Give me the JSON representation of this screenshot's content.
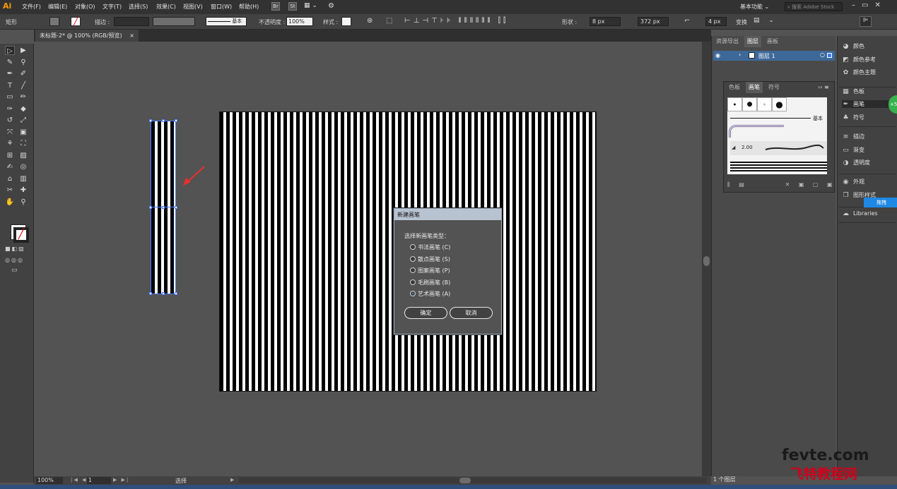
{
  "app": {
    "logo": "Ai"
  },
  "menu": [
    "文件(F)",
    "编辑(E)",
    "对象(O)",
    "文字(T)",
    "选择(S)",
    "效果(C)",
    "视图(V)",
    "窗口(W)",
    "帮助(H)"
  ],
  "menubar_right": {
    "workspace": "基本功能",
    "search_placeholder": "搜索 Adobe Stock",
    "br_label": "Br",
    "st_label": "St"
  },
  "control_bar": {
    "selection_type": "矩形",
    "stroke_label": "描边 :",
    "stroke_style": "基本",
    "opacity_label": "不透明度 :",
    "opacity_value": "100%",
    "style_label": "样式 :",
    "shape_label": "形状 :",
    "width_value": "8 px",
    "height_value": "372 px",
    "corner_value": "4 px",
    "transform_label": "变换"
  },
  "document": {
    "tab_title": "未标题-2* @ 100% (RGB/预览)",
    "close_glyph": "×"
  },
  "tools": [
    "▷",
    "▶",
    "✎",
    "⚲",
    "✒",
    "✐",
    "T",
    "╱",
    "▭",
    "✏",
    "✑",
    "◆",
    "↺",
    "⤢",
    "⤧",
    "▣",
    "⚘",
    "⛶",
    "⊞",
    "▨",
    "✍",
    "◎",
    "⌂",
    "▥",
    "✂",
    "✚",
    "✋",
    "⚲"
  ],
  "dialog": {
    "title": "新建画笔",
    "prompt": "选择新画笔类型：",
    "options": [
      {
        "label": "书法画笔 (C)",
        "selected": false
      },
      {
        "label": "散点画笔 (S)",
        "selected": false
      },
      {
        "label": "图案画笔 (P)",
        "selected": false
      },
      {
        "label": "毛刷画笔 (B)",
        "selected": false
      },
      {
        "label": "艺术画笔 (A)",
        "selected": true
      }
    ],
    "ok_label": "确定",
    "cancel_label": "取消"
  },
  "layers_panel": {
    "tabs": [
      "资源导出",
      "图层",
      "画板"
    ],
    "active_tab": "图层",
    "layer_name": "图层 1",
    "footer": "1 个图层"
  },
  "brush_panel": {
    "tabs": [
      "色板",
      "画笔",
      "符号"
    ],
    "active_tab": "画笔",
    "basic_label": "基本",
    "size_label": "2.00"
  },
  "right_dock": [
    {
      "icon": "palette-icon",
      "glyph": "◕",
      "label": "颜色"
    },
    {
      "icon": "color-guide-icon",
      "glyph": "◩",
      "label": "颜色参考"
    },
    {
      "icon": "color-theme-icon",
      "glyph": "✿",
      "label": "颜色主题"
    },
    {
      "icon": "swatches-icon",
      "glyph": "▦",
      "label": "色板"
    },
    {
      "icon": "brush-icon",
      "glyph": "✒",
      "label": "画笔"
    },
    {
      "icon": "symbols-icon",
      "glyph": "♣",
      "label": "符号"
    },
    {
      "icon": "stroke-icon",
      "glyph": "≡",
      "label": "描边"
    },
    {
      "icon": "gradient-icon",
      "glyph": "▭",
      "label": "渐变"
    },
    {
      "icon": "transparency-icon",
      "glyph": "◑",
      "label": "透明度"
    },
    {
      "icon": "appearance-icon",
      "glyph": "◉",
      "label": "外观"
    },
    {
      "icon": "graphic-styles-icon",
      "glyph": "❒",
      "label": "图形样式"
    },
    {
      "icon": "libraries-icon",
      "glyph": "☁",
      "label": "Libraries"
    }
  ],
  "badge": {
    "green_text": "+5",
    "blue_text": "拖拽"
  },
  "status": {
    "zoom": "100%",
    "page": "1",
    "tool_name": "选择"
  },
  "watermark": {
    "line1": "fevte.com",
    "line2": "飞特教程网"
  },
  "colors": {
    "accent": "#3d6999",
    "arrow": "#e8302d",
    "brand": "#ff9a00"
  }
}
